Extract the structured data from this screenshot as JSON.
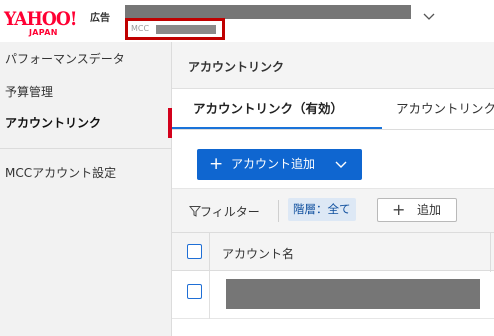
{
  "header": {
    "logo_text": "YAHOO!",
    "logo_sub": "JAPAN",
    "ad_label": "広告",
    "mcc_label": "MCC",
    "icons": {
      "account_dropdown": "chevron-down-icon"
    }
  },
  "sidebar": {
    "items": [
      {
        "label": "パフォーマンスデータ",
        "active": false
      },
      {
        "label": "予算管理",
        "active": false
      },
      {
        "label": "アカウントリンク",
        "active": true
      },
      {
        "label": "MCCアカウント設定",
        "active": false
      }
    ]
  },
  "main": {
    "title": "アカウントリンク",
    "tabs": [
      {
        "label": "アカウントリンク（有効）",
        "active": true
      },
      {
        "label": "アカウントリンク",
        "active": false
      }
    ],
    "add_button": {
      "label": "アカウント追加",
      "icon": "plus-icon",
      "dropdown_icon": "chevron-down-icon"
    },
    "filter": {
      "label": "フィルター",
      "icon": "filter-icon",
      "chip": "階層：全て",
      "add_label": "追加",
      "add_icon": "plus-icon"
    },
    "table": {
      "columns": [
        "アカウント名"
      ]
    }
  },
  "colors": {
    "brand_red": "#ff0033",
    "accent_blue": "#0f66d0",
    "active_marker": "#d3011c",
    "highlight_box": "#c00000"
  }
}
